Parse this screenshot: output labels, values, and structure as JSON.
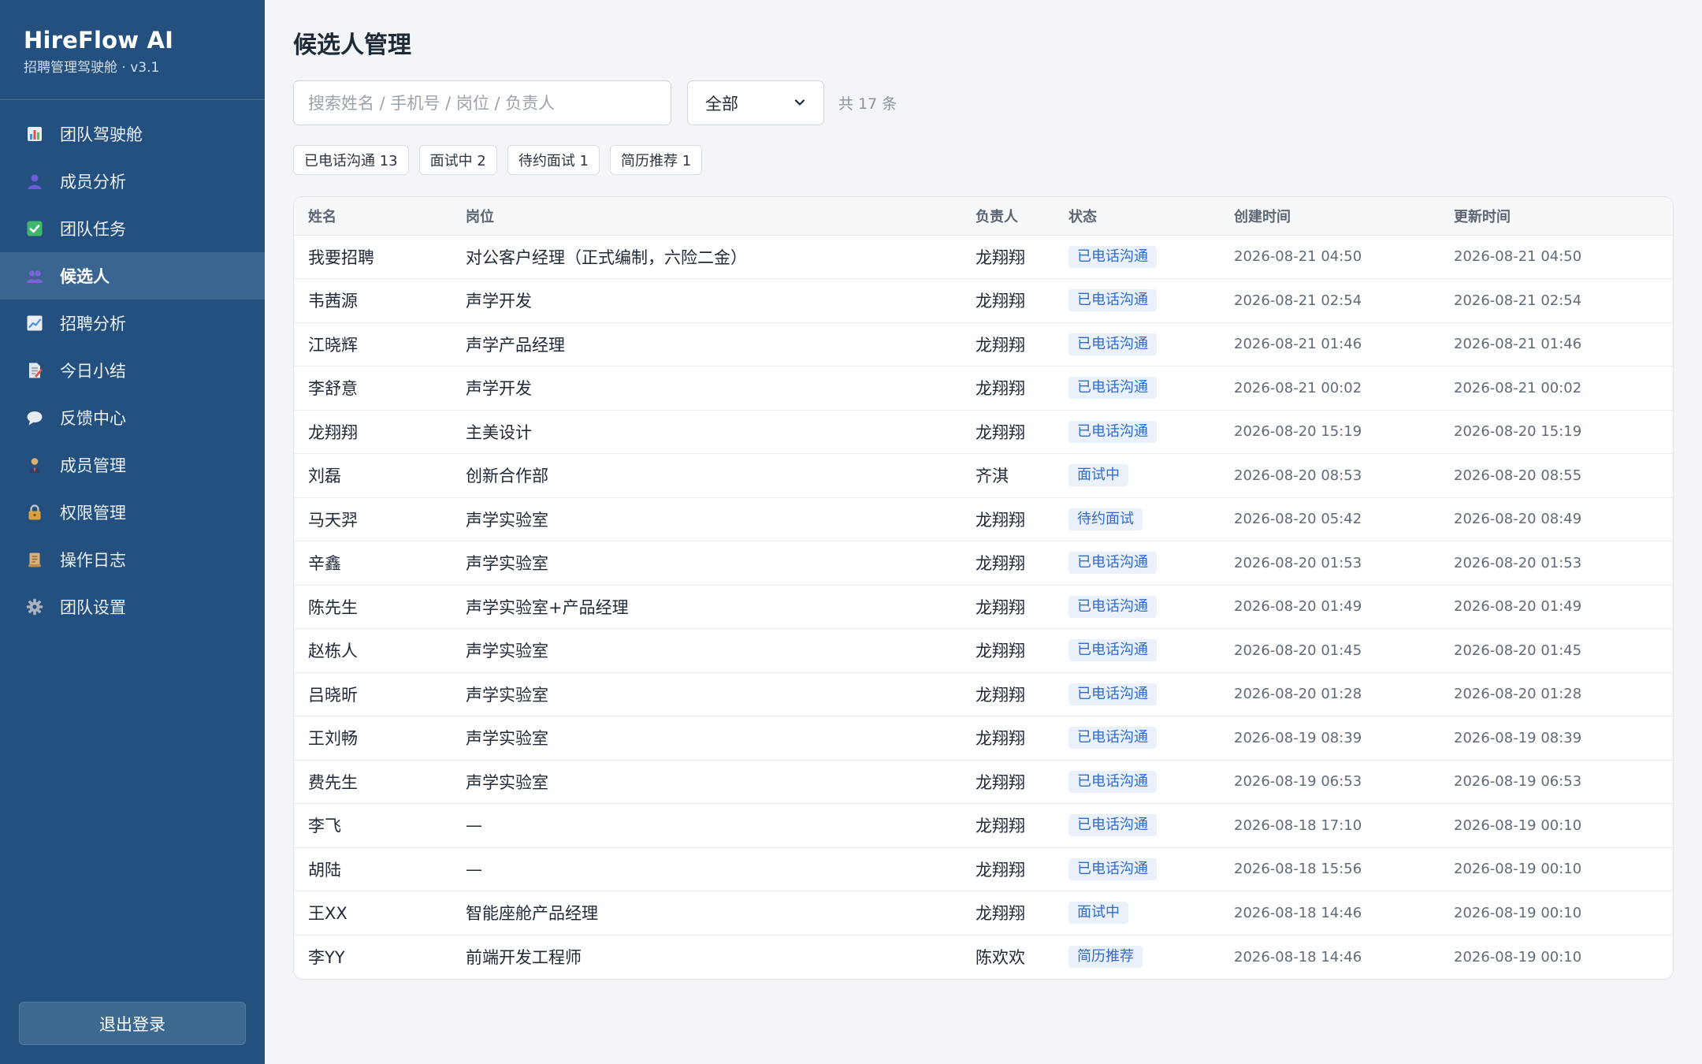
{
  "brand": {
    "title": "HireFlow AI",
    "subtitle": "招聘管理驾驶舱 · v3.1"
  },
  "nav": [
    {
      "label": "团队驾驶舱",
      "icon": "bar-chart-icon",
      "color": "#6aa3e0"
    },
    {
      "label": "成员分析",
      "icon": "person-icon",
      "color": "#6f5bd8"
    },
    {
      "label": "团队任务",
      "icon": "check-icon",
      "color": "#3fb86b"
    },
    {
      "label": "候选人",
      "icon": "people-icon",
      "color": "#7b62d6"
    },
    {
      "label": "招聘分析",
      "icon": "line-chart-icon",
      "color": "#6aa3e0"
    },
    {
      "label": "今日小结",
      "icon": "memo-icon",
      "color": "#e3e6ea"
    },
    {
      "label": "反馈中心",
      "icon": "speech-bubble-icon",
      "color": "#e8ecf0"
    },
    {
      "label": "成员管理",
      "icon": "person-tie-icon",
      "color": "#e0b070"
    },
    {
      "label": "权限管理",
      "icon": "lock-icon",
      "color": "#d9a23a"
    },
    {
      "label": "操作日志",
      "icon": "scroll-icon",
      "color": "#d8b07a"
    },
    {
      "label": "团队设置",
      "icon": "gear-icon",
      "color": "#aab4c0"
    }
  ],
  "nav_active_index": 3,
  "logout_label": "退出登录",
  "page_title": "候选人管理",
  "search": {
    "placeholder": "搜索姓名 / 手机号 / 岗位 / 负责人",
    "value": ""
  },
  "filter": {
    "selected": "全部"
  },
  "count_text": "共 17 条",
  "chips": [
    "已电话沟通 13",
    "面试中 2",
    "待约面试 1",
    "简历推荐 1"
  ],
  "table": {
    "headers": [
      "姓名",
      "岗位",
      "负责人",
      "状态",
      "创建时间",
      "更新时间"
    ],
    "rows": [
      {
        "name": "我要招聘",
        "position": "对公客户经理（正式编制，六险二金）",
        "owner": "龙翔翔",
        "status": "已电话沟通",
        "created": "2026-08-21 04:50",
        "updated": "2026-08-21 04:50"
      },
      {
        "name": "韦茜源",
        "position": "声学开发",
        "owner": "龙翔翔",
        "status": "已电话沟通",
        "created": "2026-08-21 02:54",
        "updated": "2026-08-21 02:54"
      },
      {
        "name": "江晓辉",
        "position": "声学产品经理",
        "owner": "龙翔翔",
        "status": "已电话沟通",
        "created": "2026-08-21 01:46",
        "updated": "2026-08-21 01:46"
      },
      {
        "name": "李舒意",
        "position": "声学开发",
        "owner": "龙翔翔",
        "status": "已电话沟通",
        "created": "2026-08-21 00:02",
        "updated": "2026-08-21 00:02"
      },
      {
        "name": "龙翔翔",
        "position": "主美设计",
        "owner": "龙翔翔",
        "status": "已电话沟通",
        "created": "2026-08-20 15:19",
        "updated": "2026-08-20 15:19"
      },
      {
        "name": "刘磊",
        "position": "创新合作部",
        "owner": "齐淇",
        "status": "面试中",
        "created": "2026-08-20 08:53",
        "updated": "2026-08-20 08:55"
      },
      {
        "name": "马天羿",
        "position": "声学实验室",
        "owner": "龙翔翔",
        "status": "待约面试",
        "created": "2026-08-20 05:42",
        "updated": "2026-08-20 08:49"
      },
      {
        "name": "辛鑫",
        "position": "声学实验室",
        "owner": "龙翔翔",
        "status": "已电话沟通",
        "created": "2026-08-20 01:53",
        "updated": "2026-08-20 01:53"
      },
      {
        "name": "陈先生",
        "position": "声学实验室+产品经理",
        "owner": "龙翔翔",
        "status": "已电话沟通",
        "created": "2026-08-20 01:49",
        "updated": "2026-08-20 01:49"
      },
      {
        "name": "赵栋人",
        "position": "声学实验室",
        "owner": "龙翔翔",
        "status": "已电话沟通",
        "created": "2026-08-20 01:45",
        "updated": "2026-08-20 01:45"
      },
      {
        "name": "吕晓昕",
        "position": "声学实验室",
        "owner": "龙翔翔",
        "status": "已电话沟通",
        "created": "2026-08-20 01:28",
        "updated": "2026-08-20 01:28"
      },
      {
        "name": "王刘畅",
        "position": "声学实验室",
        "owner": "龙翔翔",
        "status": "已电话沟通",
        "created": "2026-08-19 08:39",
        "updated": "2026-08-19 08:39"
      },
      {
        "name": "费先生",
        "position": "声学实验室",
        "owner": "龙翔翔",
        "status": "已电话沟通",
        "created": "2026-08-19 06:53",
        "updated": "2026-08-19 06:53"
      },
      {
        "name": "李飞",
        "position": "—",
        "owner": "龙翔翔",
        "status": "已电话沟通",
        "created": "2026-08-18 17:10",
        "updated": "2026-08-19 00:10"
      },
      {
        "name": "胡陆",
        "position": "—",
        "owner": "龙翔翔",
        "status": "已电话沟通",
        "created": "2026-08-18 15:56",
        "updated": "2026-08-19 00:10"
      },
      {
        "name": "王XX",
        "position": "智能座舱产品经理",
        "owner": "龙翔翔",
        "status": "面试中",
        "created": "2026-08-18 14:46",
        "updated": "2026-08-19 00:10"
      },
      {
        "name": "李YY",
        "position": "前端开发工程师",
        "owner": "陈欢欢",
        "status": "简历推荐",
        "created": "2026-08-18 14:46",
        "updated": "2026-08-19 00:10"
      }
    ]
  },
  "colors": {
    "sidebar": "#23507e",
    "sidebar_active": "#3a6590",
    "badge_bg": "#eaf1fb",
    "badge_text": "#2f6bd0"
  }
}
